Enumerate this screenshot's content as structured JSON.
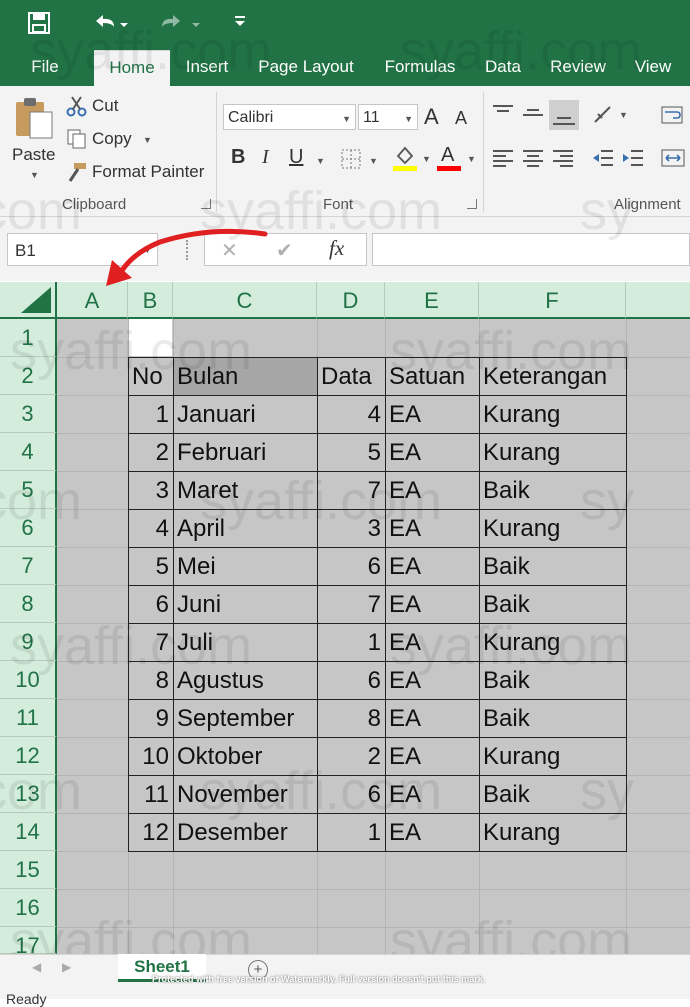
{
  "qat": {
    "save_icon": "save-icon",
    "undo_icon": "undo-icon",
    "redo_icon": "redo-icon",
    "customize_icon": "customize-qat-icon"
  },
  "tabs": [
    "File",
    "Home",
    "Insert",
    "Page Layout",
    "Formulas",
    "Data",
    "Review",
    "View"
  ],
  "ribbon": {
    "paste_label": "Paste",
    "cut_label": "Cut",
    "copy_label": "Copy",
    "format_painter_label": "Format Painter",
    "clipboard_group": "Clipboard",
    "font_name": "Calibri",
    "font_size": "11",
    "font_group": "Font",
    "alignment_group": "Alignment",
    "bold": "B",
    "italic": "I",
    "underline": "U",
    "grow_font": "A",
    "shrink_font": "A",
    "font_color_glyph": "A",
    "highlight_color": "#ffff00",
    "font_color": "#ff0000"
  },
  "formula_bar": {
    "name_box": "B1",
    "fx": "fx",
    "cancel": "✕",
    "enter": "✔",
    "value": ""
  },
  "columns": [
    "A",
    "B",
    "C",
    "D",
    "E",
    "F"
  ],
  "rows": [
    "1",
    "2",
    "3",
    "4",
    "5",
    "6",
    "7",
    "8",
    "9",
    "10",
    "11",
    "12",
    "13",
    "14",
    "15",
    "16",
    "17"
  ],
  "table": {
    "headers": [
      "No",
      "Bulan",
      "Data",
      "Satuan",
      "Keterangan"
    ],
    "rows": [
      [
        "1",
        "Januari",
        "4",
        "EA",
        "Kurang"
      ],
      [
        "2",
        "Februari",
        "5",
        "EA",
        "Kurang"
      ],
      [
        "3",
        "Maret",
        "7",
        "EA",
        "Baik"
      ],
      [
        "4",
        "April",
        "3",
        "EA",
        "Kurang"
      ],
      [
        "5",
        "Mei",
        "6",
        "EA",
        "Baik"
      ],
      [
        "6",
        "Juni",
        "7",
        "EA",
        "Baik"
      ],
      [
        "7",
        "Juli",
        "1",
        "EA",
        "Kurang"
      ],
      [
        "8",
        "Agustus",
        "6",
        "EA",
        "Baik"
      ],
      [
        "9",
        "September",
        "8",
        "EA",
        "Baik"
      ],
      [
        "10",
        "Oktober",
        "2",
        "EA",
        "Kurang"
      ],
      [
        "11",
        "November",
        "6",
        "EA",
        "Baik"
      ],
      [
        "12",
        "Desember",
        "1",
        "EA",
        "Kurang"
      ]
    ]
  },
  "sheets": {
    "active": "Sheet1",
    "add_icon": "add-sheet-icon"
  },
  "status": {
    "text": "Ready"
  },
  "watermark": {
    "text": "syaffi.com",
    "footer": "Protected with free version of Watermarkly. Full version doesn't put this mark."
  },
  "colors": {
    "excel_green": "#217346",
    "header_bg": "#d3ecdc",
    "annotation_arrow": "#e02020"
  }
}
